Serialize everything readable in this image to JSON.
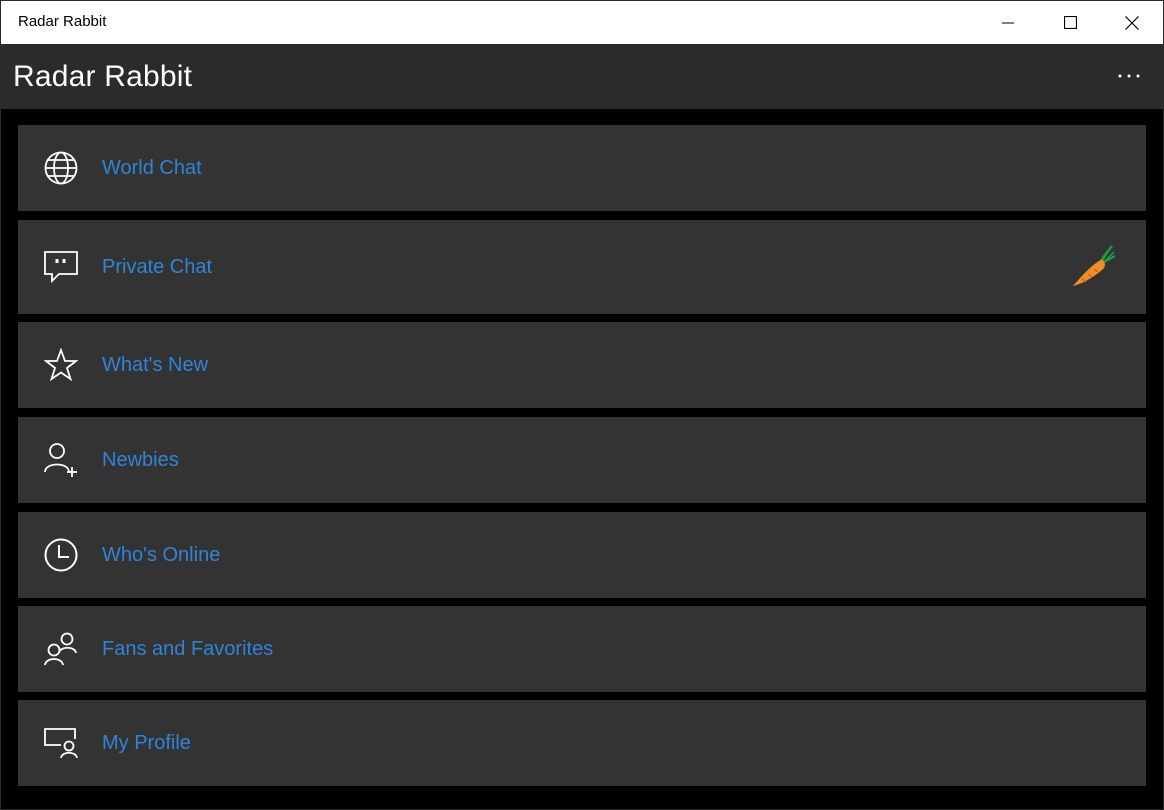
{
  "window": {
    "title": "Radar Rabbit",
    "controls": [
      "minimize-icon",
      "maximize-icon",
      "close-icon"
    ]
  },
  "appbar": {
    "title": "Radar Rabbit",
    "more_label": "···"
  },
  "colors": {
    "appbar_bg": "#2b2b2b",
    "item_bg": "#333333",
    "accent": "#2f84d8",
    "carrot": "#f28c28",
    "carrot_leaf": "#1e9a4a"
  },
  "menu": {
    "items": [
      {
        "label": "World Chat",
        "icon": "globe-icon"
      },
      {
        "label": "Private Chat",
        "icon": "chat-bubble-icon",
        "badge": "carrot-icon"
      },
      {
        "label": "What's New",
        "icon": "star-icon"
      },
      {
        "label": "Newbies",
        "icon": "add-person-icon"
      },
      {
        "label": "Who's Online",
        "icon": "clock-icon"
      },
      {
        "label": "Fans and Favorites",
        "icon": "people-icon"
      },
      {
        "label": "My Profile",
        "icon": "profile-icon"
      }
    ]
  }
}
